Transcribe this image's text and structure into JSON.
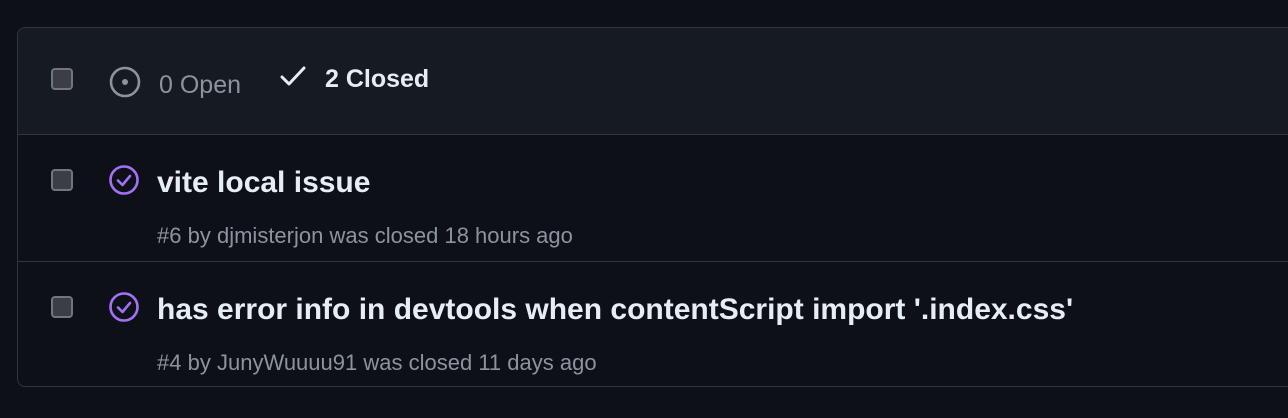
{
  "header": {
    "open_count_label": "0 Open",
    "closed_count_label": "2 Closed"
  },
  "issues": [
    {
      "title": "vite local issue",
      "number": "#6",
      "by": "by",
      "author": "djmisterjon",
      "status_text": "was closed",
      "time": "18 hours ago"
    },
    {
      "title": "has error info in devtools when contentScript import '.index.css'",
      "number": "#4",
      "by": "by",
      "author": "JunyWuuuu91",
      "status_text": "was closed",
      "time": "11 days ago"
    }
  ],
  "colors": {
    "background": "#0d1117",
    "header_background": "#161b22",
    "border": "#30363d",
    "closed_icon": "#a371f7",
    "muted_text": "#8b949e"
  },
  "icons": {
    "open": "issue-opened-icon",
    "closed_filter": "check-icon",
    "issue_closed": "issue-closed-icon"
  }
}
